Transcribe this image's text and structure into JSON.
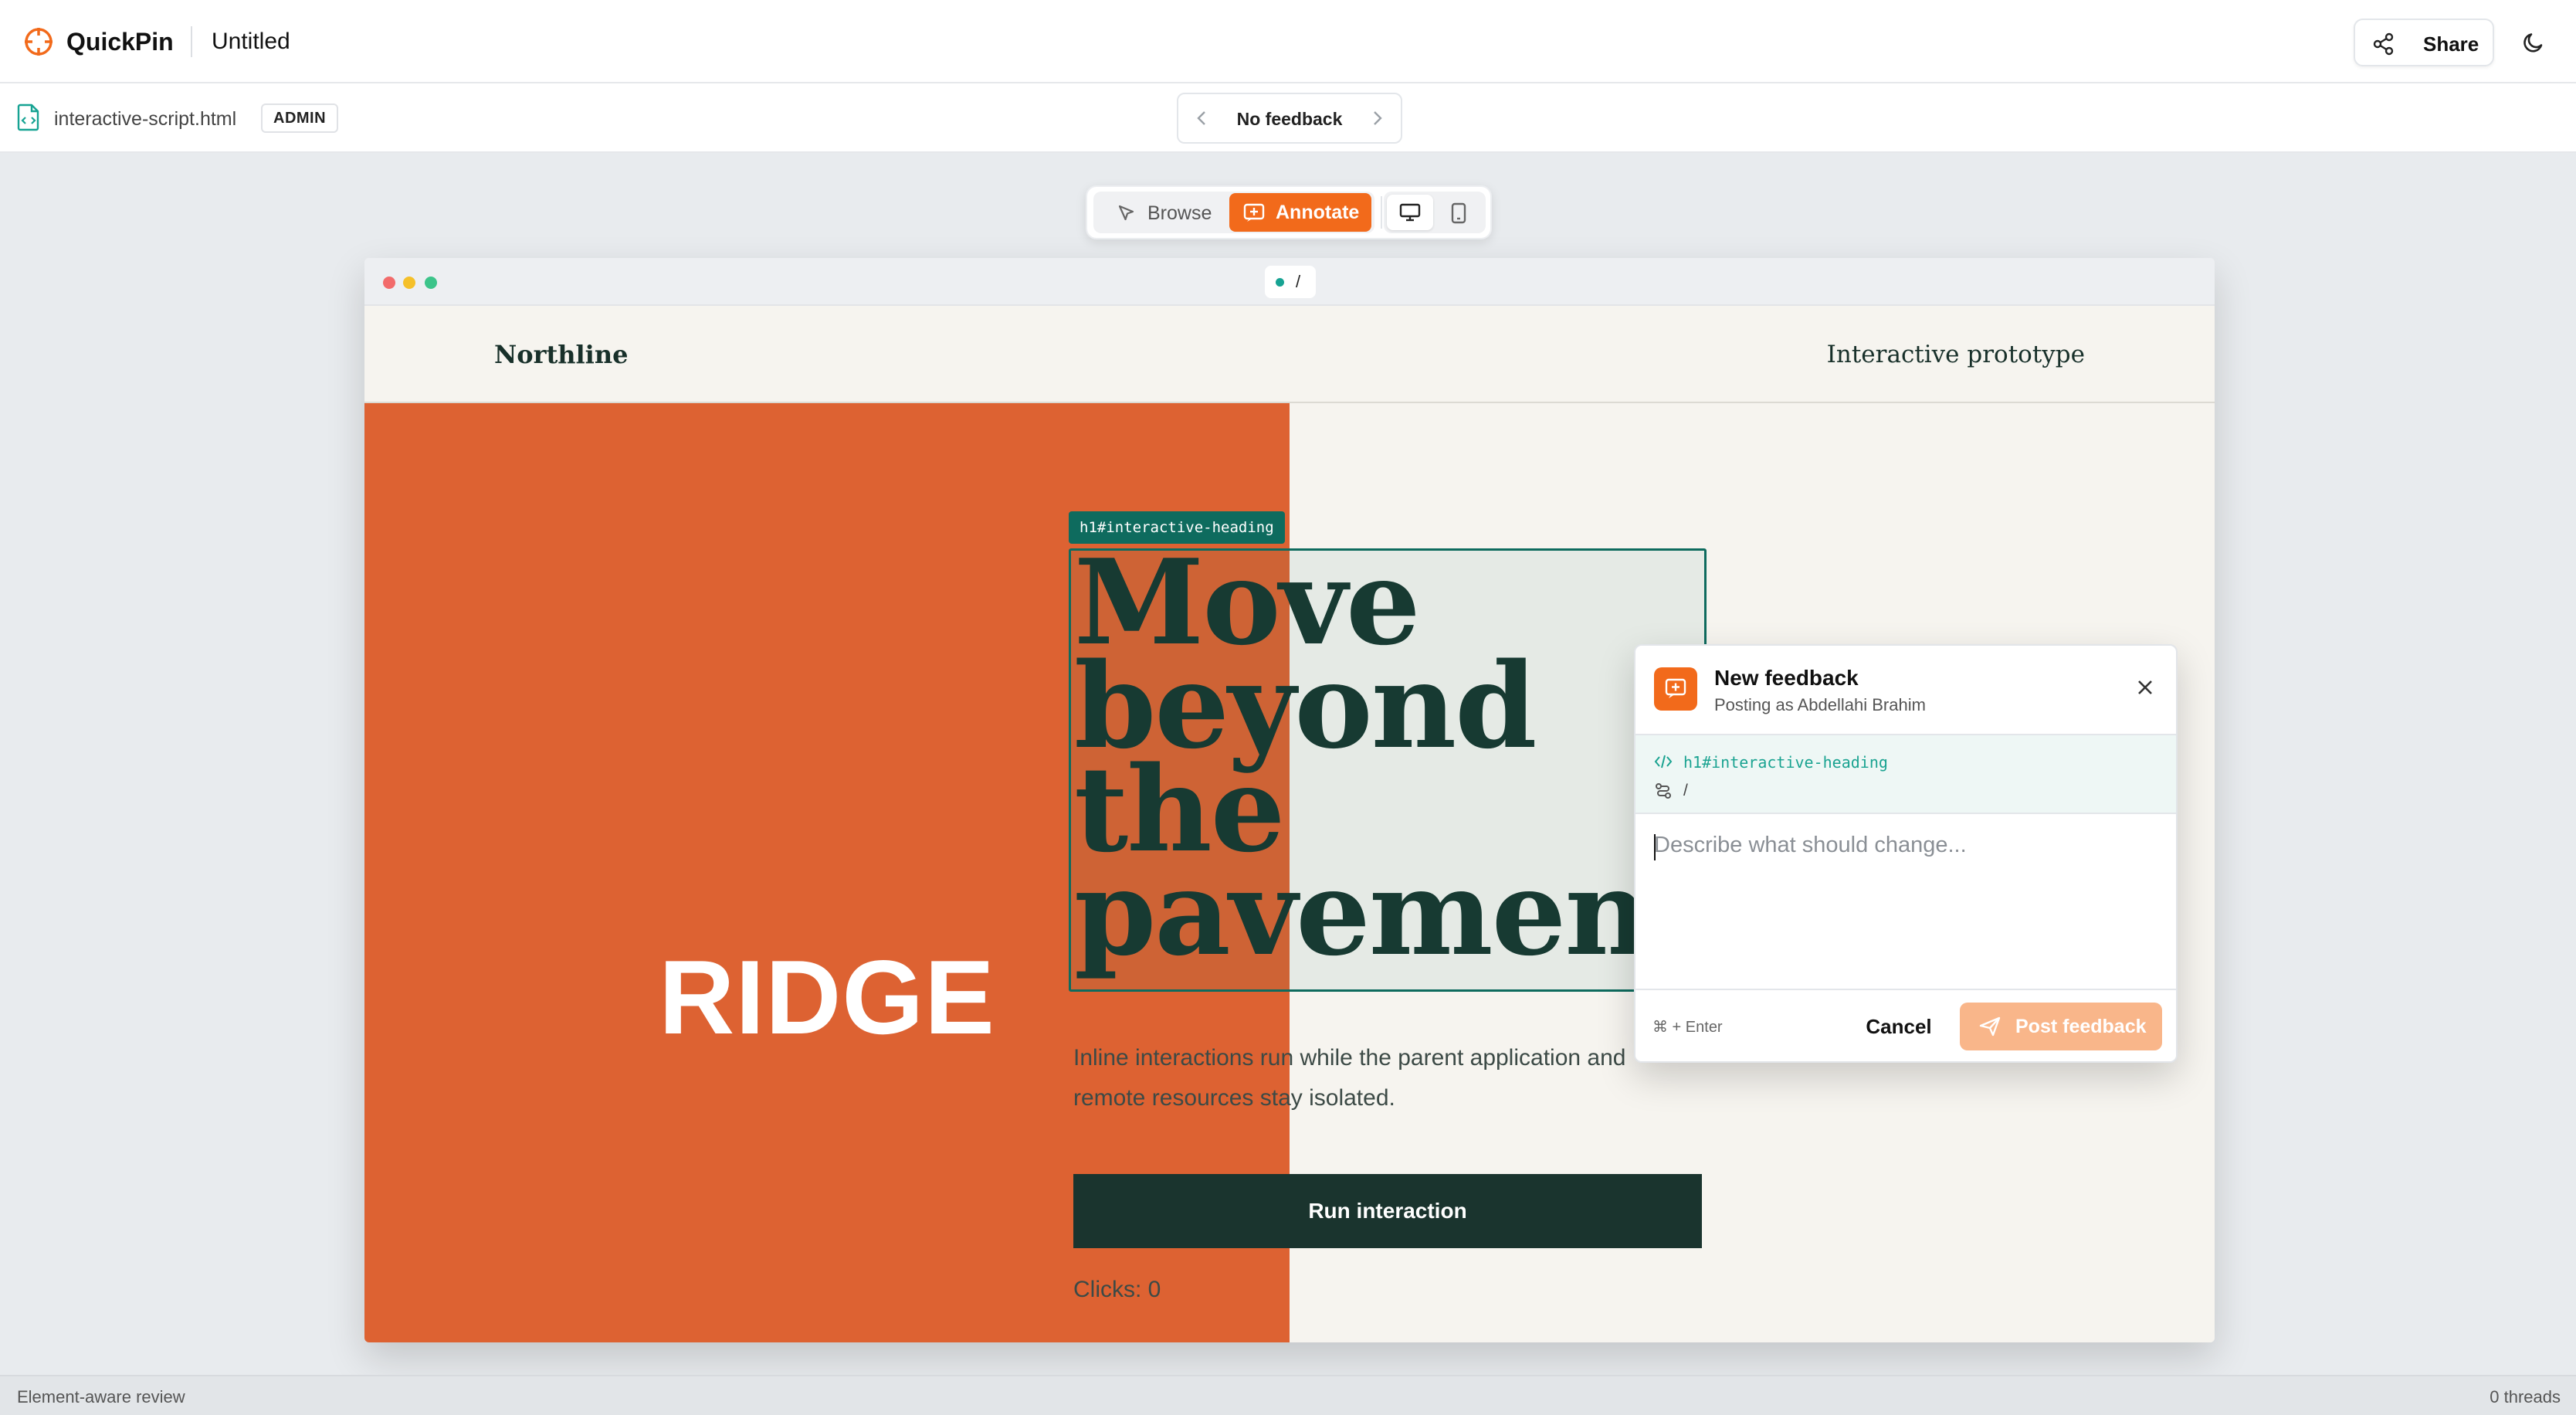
{
  "app": {
    "name": "QuickPin",
    "document_title": "Untitled",
    "share_label": "Share",
    "accent_color": "#f26a1b",
    "selection_color": "#0e6b5e"
  },
  "subbar": {
    "file_name": "interactive-script.html",
    "role_badge": "ADMIN",
    "feedback_nav_label": "No feedback"
  },
  "modes": {
    "browse_label": "Browse",
    "annotate_label": "Annotate",
    "active_mode": "Annotate",
    "active_device": "desktop"
  },
  "preview": {
    "url_path": "/",
    "site_brand": "Northline",
    "site_tagline": "Interactive prototype",
    "hero_word": "RIDGE",
    "hero_color": "#dd6232",
    "heading_lines": [
      "Move",
      "beyond",
      "the",
      "pavement"
    ],
    "lede": "Inline interactions run while the parent application and remote resources stay isolated.",
    "button_label": "Run interaction",
    "clicks_text": "Clicks: 0",
    "selected_element": "h1#interactive-heading"
  },
  "feedback_popover": {
    "title": "New feedback",
    "subtitle": "Posting as Abdellahi Brahim",
    "target_selector": "h1#interactive-heading",
    "target_route": "/",
    "placeholder": "Describe what should change...",
    "shortcut_hint": "⌘ + Enter",
    "cancel_label": "Cancel",
    "post_label": "Post feedback"
  },
  "statusbar": {
    "left_text": "Element-aware review",
    "right_text": "0 threads"
  }
}
